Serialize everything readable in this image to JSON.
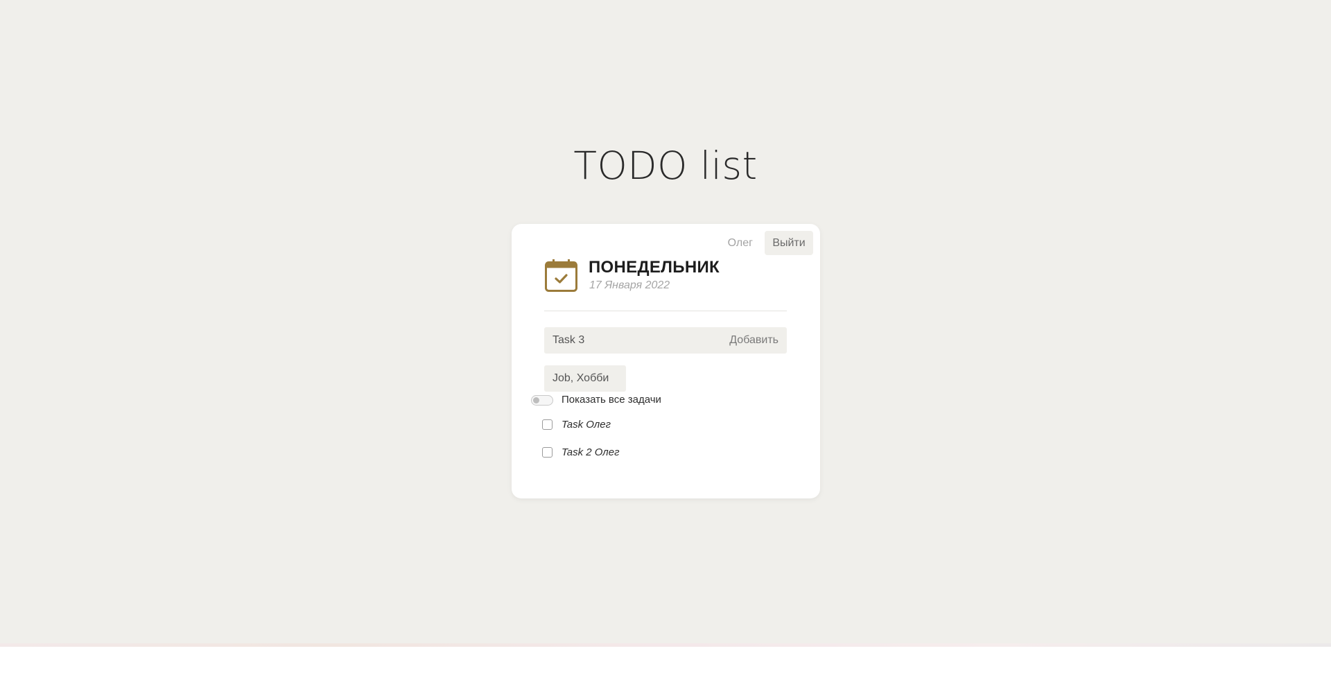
{
  "app": {
    "title": "TODO list"
  },
  "card": {
    "user_name": "Олег",
    "logout_label": "Выйти",
    "day_title": "ПОНЕДЕЛЬНИК",
    "date": "17 Января 2022",
    "task_input": {
      "value": "Task 3",
      "placeholder": ""
    },
    "add_label": "Добавить",
    "tags_input": {
      "value": "Job, Хобби",
      "placeholder": ""
    },
    "show_all": {
      "label": "Показать все задачи",
      "enabled": false
    },
    "tasks": [
      {
        "label": "Task Олег",
        "done": false
      },
      {
        "label": "Task 2 Олег",
        "done": false
      }
    ]
  },
  "colors": {
    "background": "#f0efeb",
    "card": "#ffffff",
    "accent": "#9b7b3a"
  },
  "icons": {
    "calendar": "calendar-check-icon"
  }
}
